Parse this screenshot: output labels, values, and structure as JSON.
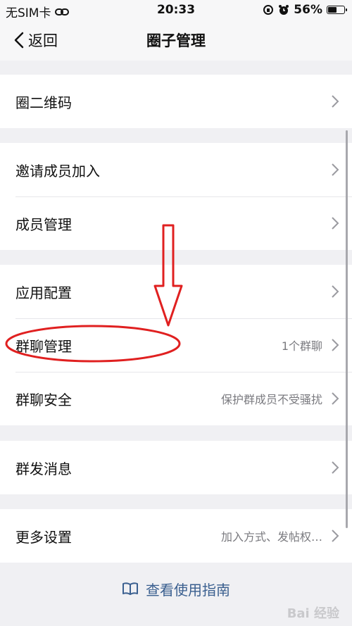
{
  "status_bar": {
    "carrier": "无SIM卡",
    "time": "20:33",
    "battery_percent": "56%",
    "battery_level": 0.56
  },
  "nav": {
    "back_label": "返回",
    "title": "圈子管理"
  },
  "sections": [
    {
      "items": [
        {
          "label": "圈二维码",
          "value": ""
        }
      ]
    },
    {
      "items": [
        {
          "label": "邀请成员加入",
          "value": ""
        },
        {
          "label": "成员管理",
          "value": ""
        }
      ]
    },
    {
      "items": [
        {
          "label": "应用配置",
          "value": ""
        },
        {
          "label": "群聊管理",
          "value": "1个群聊"
        },
        {
          "label": "群聊安全",
          "value": "保护群成员不受骚扰"
        }
      ]
    },
    {
      "items": [
        {
          "label": "群发消息",
          "value": ""
        }
      ]
    },
    {
      "items": [
        {
          "label": "更多设置",
          "value": "加入方式、发帖权…"
        }
      ]
    }
  ],
  "guide_link": "查看使用指南",
  "watermark": "Bai 经验",
  "colors": {
    "link": "#3a5f8f",
    "annotation": "#e02020",
    "background": "#f0f0f3"
  }
}
